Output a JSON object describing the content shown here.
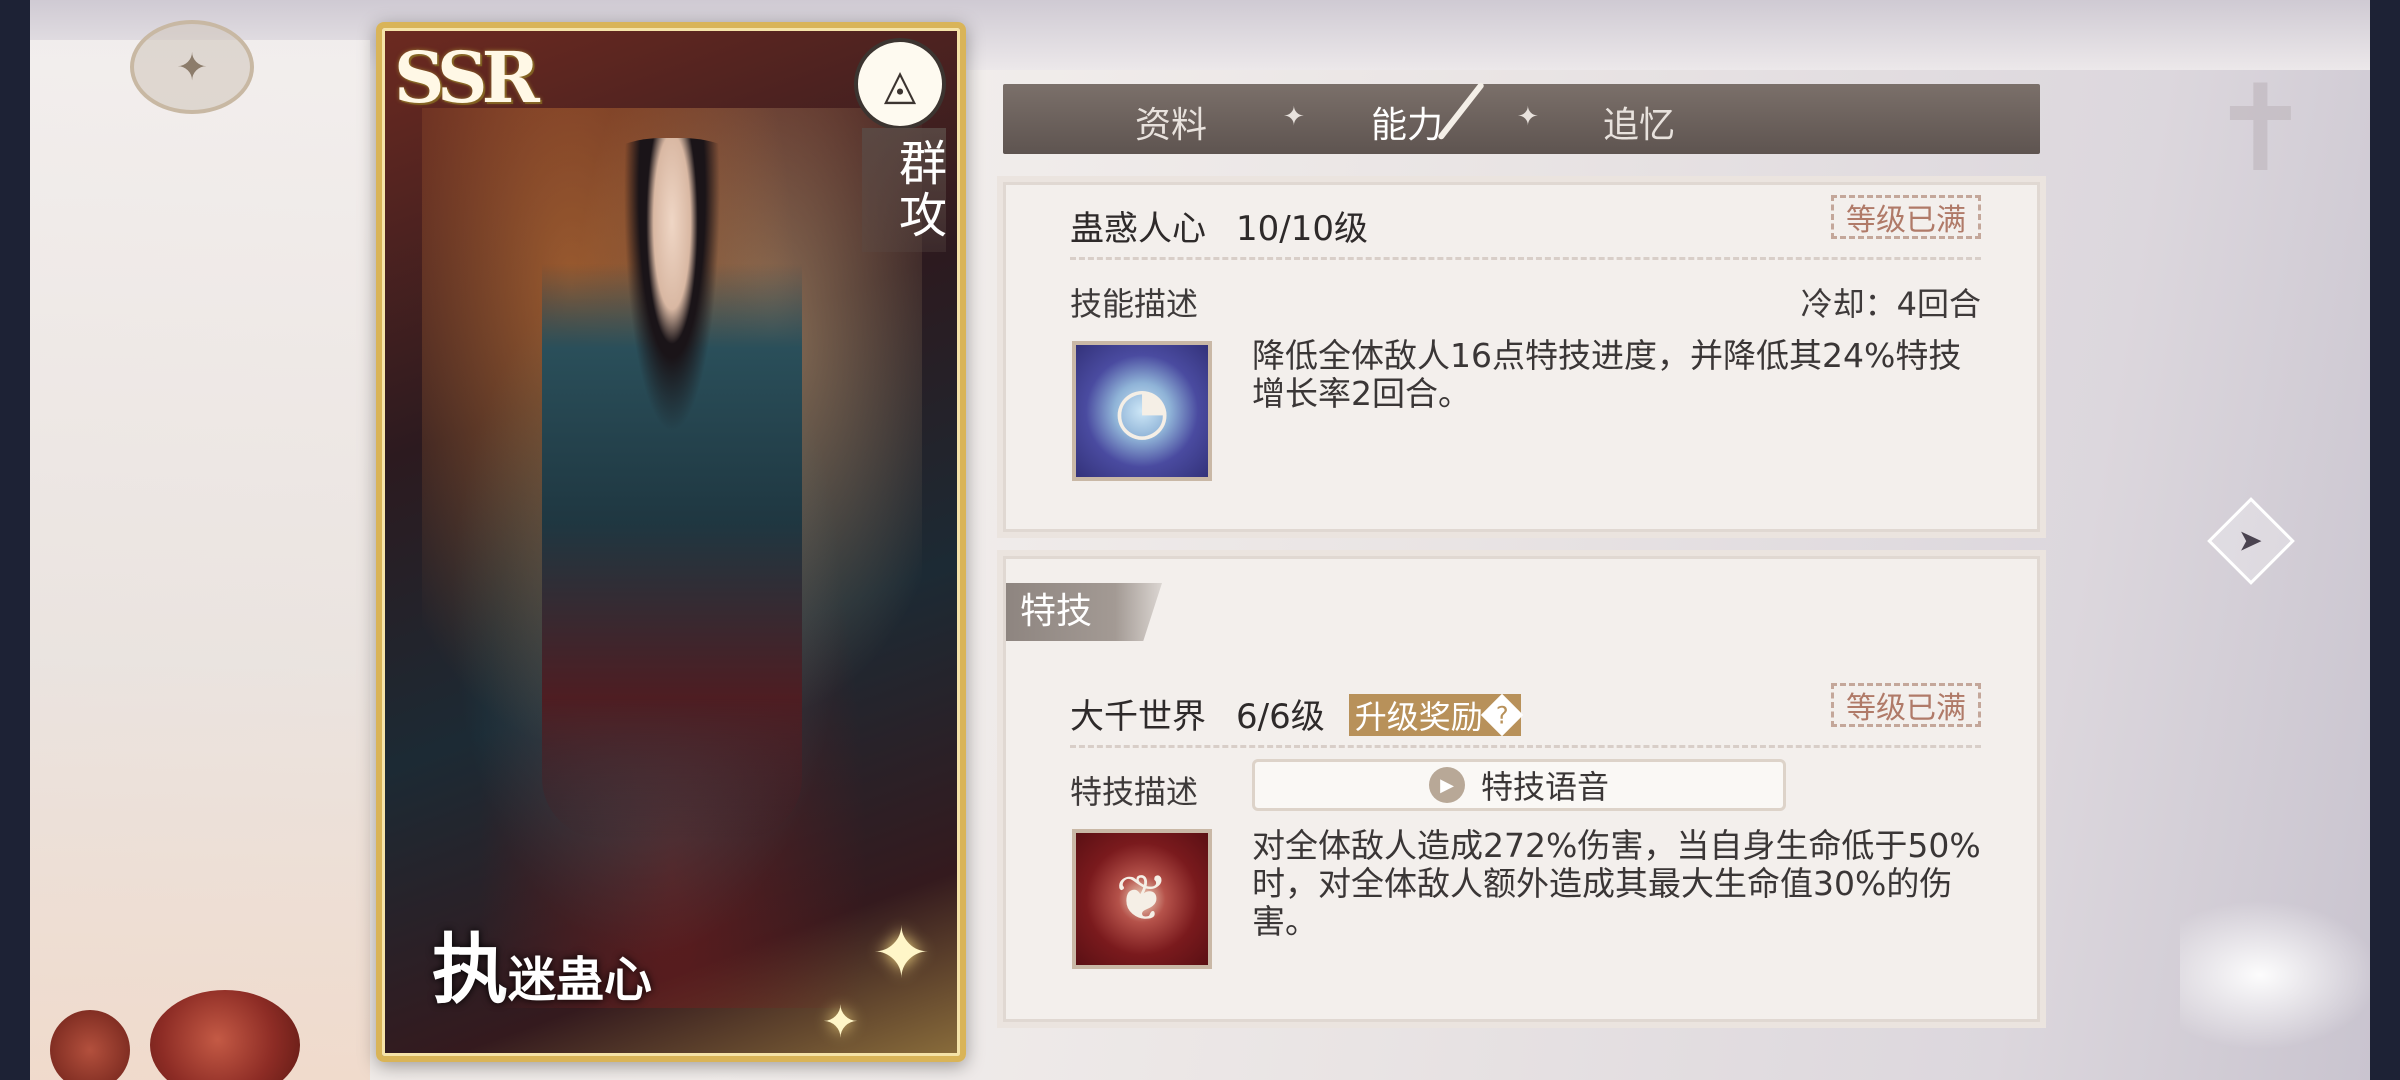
{
  "card": {
    "rarity": "SSR",
    "attack_type": "群攻",
    "name_big": "执",
    "name_small": "迷蛊心"
  },
  "tabs": [
    {
      "label": "资料",
      "active": false
    },
    {
      "label": "能力",
      "active": true
    },
    {
      "label": "追忆",
      "active": false
    }
  ],
  "skill": {
    "name": "蛊惑人心",
    "level": "10/10级",
    "max_label": "等级已满",
    "desc_label": "技能描述",
    "cooldown": "冷却：4回合",
    "description": "降低全体敌人16点特技进度，并降低其24%特技增长率2回合。"
  },
  "special": {
    "section_label": "特技",
    "name": "大千世界",
    "level": "6/6级",
    "upgrade_reward": "升级奖励",
    "max_label": "等级已满",
    "desc_label": "特技描述",
    "voice_button": "特技语音",
    "description": "对全体敌人造成272%伤害，当自身生命低于50%时，对全体敌人额外造成其最大生命值30%的伤害。"
  },
  "icons": {
    "class_icon": "triangle-circle-icon",
    "next_arrow": "next-arrow-icon",
    "skill_icon": "blue-orb-icon",
    "special_icon": "red-swirl-icon"
  }
}
